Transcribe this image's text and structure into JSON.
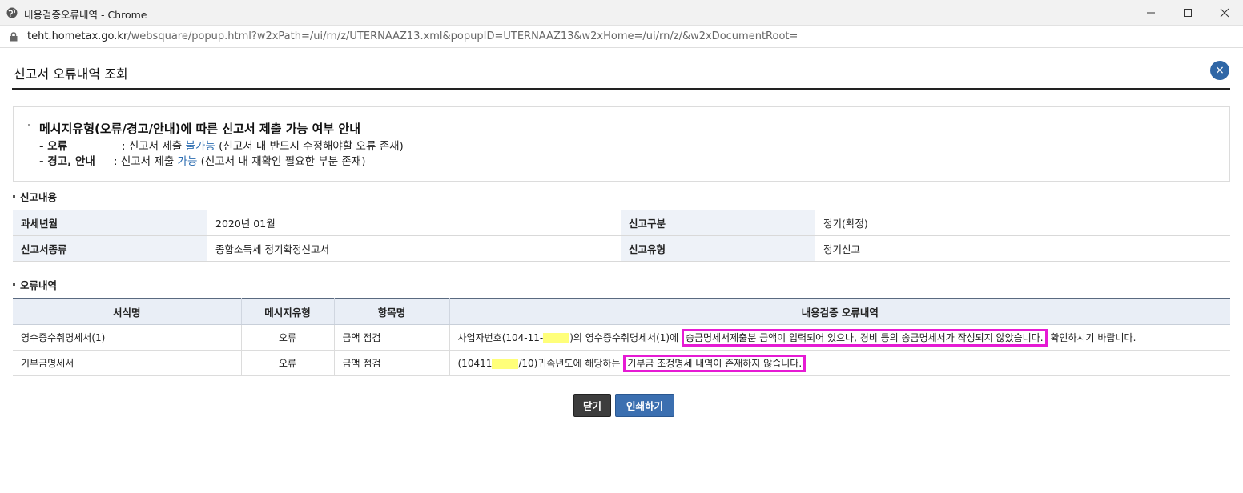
{
  "window": {
    "title": "내용검증오류내역 - Chrome",
    "url_host": "teht.hometax.go.kr",
    "url_path": "/websquare/popup.html?w2xPath=/ui/rn/z/UTERNAAZ13.xml&popupID=UTERNAAZ13&w2xHome=/ui/rn/z/&w2xDocumentRoot="
  },
  "popup": {
    "title": "신고서 오류내역 조회",
    "close_symbol": "×"
  },
  "guide": {
    "title": "메시지유형(오류/경고/안내)에 따른 신고서 제출 가능 여부 안내",
    "error_tag": "- 오류",
    "error_prefix": ": 신고서 제출 ",
    "error_status": "불가능",
    "error_suffix": " (신고서 내 반드시 수정해야할 오류 존재)",
    "warn_tag": "- 경고, 안내",
    "warn_prefix": ": 신고서 제출 ",
    "warn_status": "가능",
    "warn_suffix": " (신고서 내 재확인 필요한 부분 존재)"
  },
  "report_section": {
    "heading": "신고내용",
    "rows": [
      {
        "label1": "과세년월",
        "value1": "2020년 01월",
        "label2": "신고구분",
        "value2": "정기(확정)"
      },
      {
        "label1": "신고서종류",
        "value1": "종합소득세 정기확정신고서",
        "label2": "신고유형",
        "value2": "정기신고"
      }
    ]
  },
  "error_section": {
    "heading": "오류내역",
    "columns": [
      "서식명",
      "메시지유형",
      "항목명",
      "내용검증 오류내역"
    ],
    "rows": [
      {
        "form": "영수증수취명세서(1)",
        "type": "오류",
        "item": "금액 점검",
        "detail_prefix": "사업자번호(104-11-",
        "detail_mid": ")의 영수증수취명세서(1)에 ",
        "detail_highlight": "송금명세서제출분 금액이 입력되어 있으나, 경비 등의 송금명세서가 작성되지 않았습니다.",
        "detail_suffix": " 확인하시기 바랍니다."
      },
      {
        "form": "기부금명세서",
        "type": "오류",
        "item": "금액 점검",
        "detail_prefix": "(10411",
        "detail_mid": "/10)귀속년도에 해당하는 ",
        "detail_highlight": "기부금 조정명세 내역이 존재하지 않습니다.",
        "detail_suffix": ""
      }
    ]
  },
  "buttons": {
    "close": "닫기",
    "print": "인쇄하기"
  },
  "colors": {
    "accent_blue": "#3b6fb0",
    "highlight_box": "#e61bd4",
    "mask_yellow": "#ffff7a"
  }
}
